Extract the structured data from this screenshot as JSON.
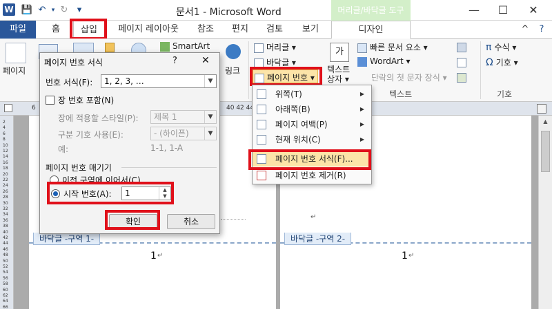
{
  "window": {
    "title": "문서1  -  Microsoft Word",
    "context_tools": "머리글/바닥글 도구",
    "context_tab": "디자인",
    "minimize": "—",
    "maximize": "☐",
    "close": "✕"
  },
  "quick_access": {
    "logo": "W",
    "save": "💾",
    "undo": "↶",
    "redo": "↻",
    "more": "▾"
  },
  "tabs": [
    "파일",
    "홈",
    "삽입",
    "페이지 레이아웃",
    "참조",
    "편지",
    "검토",
    "보기"
  ],
  "tab_right": {
    "collapse": "^",
    "help": "?"
  },
  "ribbon": {
    "page_label": "페이지",
    "smartart": "SmartArt",
    "link": "링크",
    "header": "머리글 ▾",
    "footer": "바닥글 ▾",
    "page_number": "페이지 번호 ▾",
    "textbox": "텍스트\n상자 ▾",
    "quick_parts": "빠른 문서 요소 ▾",
    "wordart": "WordArt ▾",
    "dropcap": "단락의 첫 문자 장식 ▾",
    "equation": "수식 ▾",
    "symbol": "기호 ▾",
    "group_text": "텍스트",
    "group_symbols": "기호"
  },
  "ruler": {
    "left_mark": "6",
    "right_marks": "40 42 44"
  },
  "dialog": {
    "title": "페이지 번호 서식",
    "help": "?",
    "close": "✕",
    "format_label": "번호 서식(F):",
    "format_value": "1, 2, 3, …",
    "include_chapter": "장 번호 포함(N)",
    "chapter_style_label": "장에 적용할 스타일(P):",
    "chapter_style_value": "제목 1",
    "separator_label": "구분 기호 사용(E):",
    "separator_value": "-  (하이픈)",
    "example_label": "예:",
    "example_value": "1-1, 1-A",
    "numbering_section": "페이지 번호 매기기",
    "continue_option": "이전 구역에 이어서(C)",
    "start_at_label": "시작 번호(A):",
    "start_at_value": "1",
    "ok": "확인",
    "cancel": "취소"
  },
  "menu": {
    "items": [
      "위쪽(T)",
      "아래쪽(B)",
      "페이지 여백(P)",
      "현재 위치(C)",
      "페이지 번호 서식(F)...",
      "페이지 번호 제거(R)"
    ]
  },
  "document": {
    "footer1": "바닥글 -구역 1-",
    "footer2": "바닥글 -구역 2-",
    "page1_number": "1",
    "page2_number": "1",
    "para_mark": "↵"
  },
  "vruler_marks": [
    "2",
    "4",
    "6",
    "8",
    "10",
    "12",
    "14",
    "16",
    "18",
    "20",
    "22",
    "24",
    "26",
    "28",
    "30",
    "32",
    "34",
    "36",
    "38",
    "40",
    "42",
    "44",
    "46",
    "48",
    "50",
    "52",
    "54",
    "56",
    "58",
    "60",
    "62",
    "64",
    "66"
  ],
  "colors": {
    "file_tab": "#2a579a",
    "highlight": "#e0101a",
    "context": "#d3efc9",
    "footer_tag": "#e2ecf8"
  }
}
